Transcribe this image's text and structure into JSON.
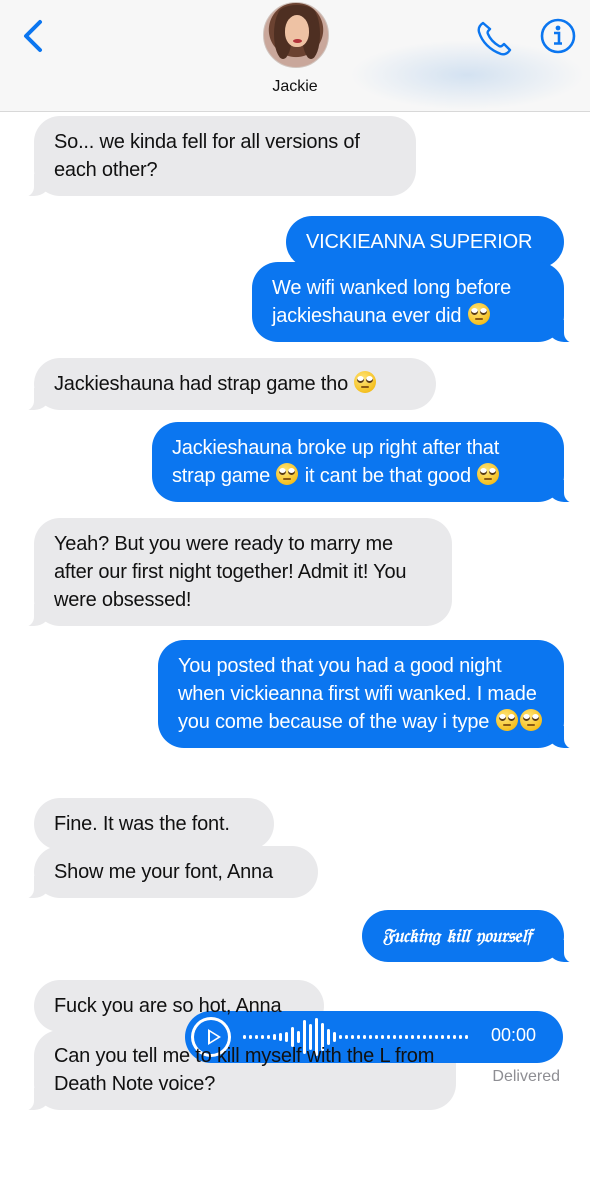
{
  "header": {
    "back_icon": "chevron-left-icon",
    "contact_name": "Jackie",
    "phone_icon": "phone-icon",
    "info_icon": "info-icon",
    "accent_color": "#0b76f0"
  },
  "messages": [
    {
      "from": "contact",
      "text": "So... we kinda fell for all versions of each other?"
    },
    {
      "from": "me",
      "text": "VICKIEANNA SUPERIOR"
    },
    {
      "from": "me",
      "text": "We wifi wanked long before jackieshauna ever did",
      "emoji": "face-with-rolling-eyes"
    },
    {
      "from": "contact",
      "text": "Jackieshauna had strap game tho",
      "emoji": "face-with-rolling-eyes"
    },
    {
      "from": "me",
      "text_parts": [
        "Jackieshauna broke up right after that strap game",
        "it cant be that good"
      ],
      "emoji": "face-with-rolling-eyes"
    },
    {
      "from": "contact",
      "text": "Yeah? But you were ready to marry me after our first night together! Admit it! You were obsessed!"
    },
    {
      "from": "me",
      "text": "You posted that you had a good night when vickieanna first wifi wanked. I made you come because of the way i type",
      "emoji": "face-with-rolling-eyes x2"
    },
    {
      "from": "contact",
      "text": "Fine. It was the font."
    },
    {
      "from": "contact",
      "text": "Show me your font, Anna"
    },
    {
      "from": "me",
      "text": "𝔉𝔲𝔠𝔨𝔦𝔫𝔤 𝔨𝔦𝔩𝔩 𝔶𝔬𝔲𝔯𝔰𝔢𝔩𝔣"
    },
    {
      "from": "contact",
      "text": "Fuck you are so hot, Anna"
    },
    {
      "from": "contact",
      "text": "Can you tell me to kill myself with the L from Death Note voice?"
    }
  ],
  "audio_message": {
    "play_icon": "play-icon",
    "duration": "00:00"
  },
  "status": "Delivered"
}
